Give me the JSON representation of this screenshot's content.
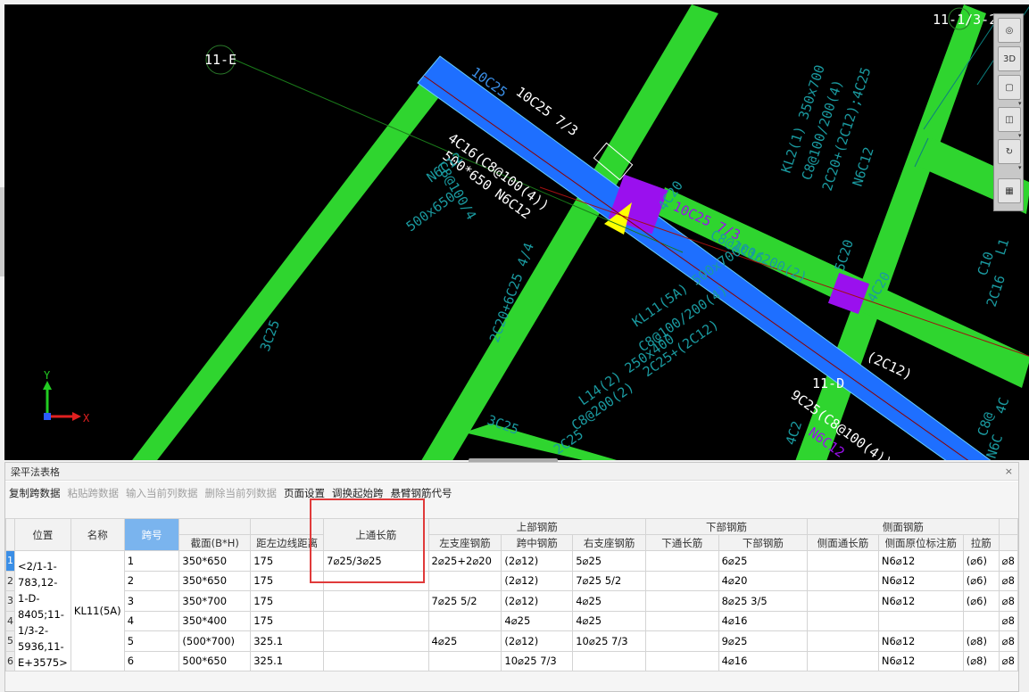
{
  "viewport": {
    "labels": {
      "axis_11E": "11-E",
      "axis_11D": "11-D",
      "axis_corner": "11-1/3-2",
      "beam_main_1": "10C25",
      "beam_main_2": "10C25 7/3",
      "beam_main_3": "4C16(C8@100(4))",
      "beam_main_4": "500*650 N6C12",
      "beam_left_1": "C8@100/4",
      "beam_left_2": "N6C12",
      "beam_left_3": "500x650",
      "beam_small": "3C25",
      "mid_1": "2C20+6C25 4/4",
      "mid_2": "3C25",
      "right_1": "4C20",
      "right_2": "10C25 7/3",
      "right_3": "C8@100/200(2)",
      "right_4": "4C16",
      "kl11_1": "KL11(5A) 500x700",
      "kl11_2": "C8@100/200(4)",
      "kl11_3": "2C25+(2C12)",
      "kl11_4": "N6C12",
      "l14_1": "L14(2) 250x400",
      "l14_2": "C8@200(2)",
      "l14_3": "2C25",
      "l14_4": "3C25",
      "kl2_1": "KL2(1) 350x700",
      "kl2_2": "C8@100/200(4)",
      "kl2_3": "2C20+(2C12);4C25",
      "kl2_4": "N6C12",
      "lbl_5c20": "5C20",
      "lbl_4c20": "4C20",
      "lbl_2c12": "(2C12)",
      "lbl_9c25": "9C25(C8@100(4))",
      "lbl_n6c12": "N6C12",
      "lbl_4c2": "4C2",
      "lbl_right_edge_1": "L1",
      "lbl_right_edge_2": "C10",
      "lbl_right_edge_3": "2C16",
      "lbl_4c": "4C",
      "lbl_c8": "C8@",
      "lbl_n6c": "N6C",
      "axis_y": "Y",
      "axis_x": "X"
    },
    "view_tools": [
      "3D"
    ]
  },
  "panel": {
    "title": "梁平法表格",
    "close": "×",
    "toolbar": [
      {
        "label": "复制跨数据",
        "enabled": true
      },
      {
        "label": "粘贴跨数据",
        "enabled": false
      },
      {
        "label": "输入当前列数据",
        "enabled": false
      },
      {
        "label": "删除当前列数据",
        "enabled": false
      },
      {
        "label": "页面设置",
        "enabled": true
      },
      {
        "label": "调换起始跨",
        "enabled": true
      },
      {
        "label": "悬臂钢筋代号",
        "enabled": true
      }
    ],
    "headers": {
      "position": "位置",
      "name": "名称",
      "span": "跨号",
      "section": "截面(B*H)",
      "dist": "距左边线距离",
      "top_through": "上通长筋",
      "top_group": "上部钢筋",
      "left_support": "左支座钢筋",
      "mid_span": "跨中钢筋",
      "right_support": "右支座钢筋",
      "bottom_group": "下部钢筋",
      "bottom_through": "下通长筋",
      "bottom_bar": "下部钢筋",
      "side_group": "侧面钢筋",
      "side_through": "侧面通长筋",
      "side_orig": "侧面原位标注筋",
      "tie": "拉筋"
    },
    "position_value": "<2/1-1-783,12-1-D-8405;11-1/3-2-5936,11-E+3575>",
    "name_value": "KL11(5A)",
    "rows": [
      {
        "rn": "1",
        "span": "1",
        "section": "350*650",
        "dist": "175",
        "top_through": "7⌀25/3⌀25",
        "left": "2⌀25+2⌀20",
        "mid": "(2⌀12)",
        "right": "5⌀25",
        "bthrough": "",
        "bottom": "6⌀25",
        "sthrough": "",
        "sorig": "N6⌀12",
        "tie": "(⌀6)",
        "extra": "⌀8"
      },
      {
        "rn": "2",
        "span": "2",
        "section": "350*650",
        "dist": "175",
        "top_through": "",
        "left": "",
        "mid": "(2⌀12)",
        "right": "7⌀25 5/2",
        "bthrough": "",
        "bottom": "4⌀20",
        "sthrough": "",
        "sorig": "N6⌀12",
        "tie": "(⌀6)",
        "extra": "⌀8"
      },
      {
        "rn": "3",
        "span": "3",
        "section": "350*700",
        "dist": "175",
        "top_through": "",
        "left": "7⌀25 5/2",
        "mid": "(2⌀12)",
        "right": "4⌀25",
        "bthrough": "",
        "bottom": "8⌀25 3/5",
        "sthrough": "",
        "sorig": "N6⌀12",
        "tie": "(⌀6)",
        "extra": "⌀8"
      },
      {
        "rn": "4",
        "span": "4",
        "section": "350*400",
        "dist": "175",
        "top_through": "",
        "left": "",
        "mid": "4⌀25",
        "right": "4⌀25",
        "bthrough": "",
        "bottom": "4⌀16",
        "sthrough": "",
        "sorig": "",
        "tie": "",
        "extra": "⌀8"
      },
      {
        "rn": "5",
        "span": "5",
        "section": "(500*700)",
        "dist": "325.1",
        "top_through": "",
        "left": "4⌀25",
        "mid": "(2⌀12)",
        "right": "10⌀25 7/3",
        "bthrough": "",
        "bottom": "9⌀25",
        "sthrough": "",
        "sorig": "N6⌀12",
        "tie": "(⌀8)",
        "extra": "⌀8"
      },
      {
        "rn": "6",
        "span": "6",
        "section": "500*650",
        "dist": "325.1",
        "top_through": "",
        "left": "",
        "mid": "10⌀25 7/3",
        "right": "",
        "bthrough": "",
        "bottom": "4⌀16",
        "sthrough": "",
        "sorig": "N6⌀12",
        "tie": "(⌀8)",
        "extra": "⌀8"
      }
    ]
  },
  "colors": {
    "green_beam": "#2fd52f",
    "blue_beam": "#1e6fff",
    "cyan_text": "#1a9aa0",
    "purple": "#9a10ee",
    "yellow": "#ffff00",
    "highlight_red": "#e03a3a"
  }
}
